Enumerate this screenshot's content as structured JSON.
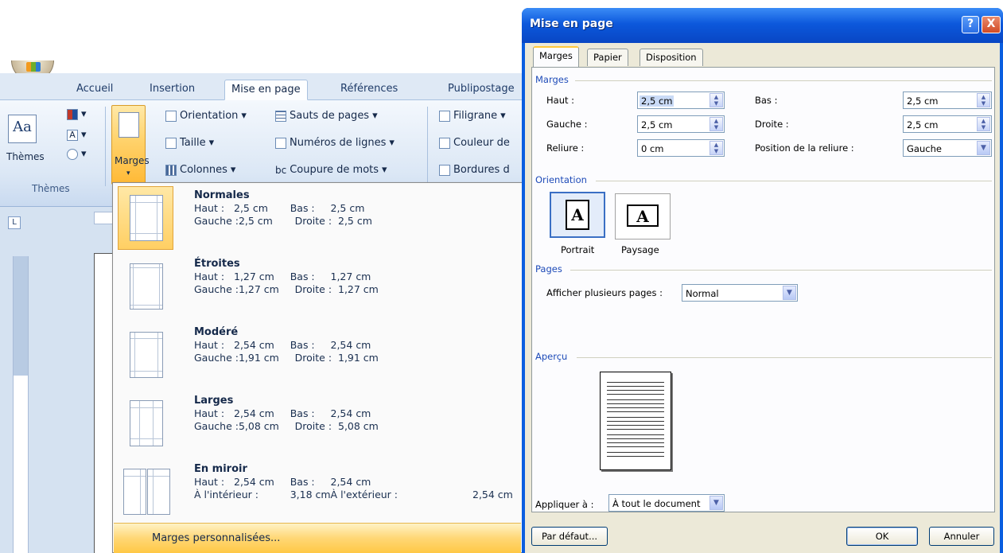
{
  "ribbon": {
    "tabs": [
      "Accueil",
      "Insertion",
      "Mise en page",
      "Références",
      "Publipostage"
    ],
    "active_tab": "Mise en page",
    "themes_label": "Thèmes",
    "themes_group": "Thèmes",
    "marges_label": "Marges",
    "orientation": "Orientation",
    "taille": "Taille",
    "colonnes": "Colonnes",
    "sauts": "Sauts de pages",
    "numeros": "Numéros de lignes",
    "coupure": "Coupure de mots",
    "filigrane": "Filigrane",
    "couleur": "Couleur de",
    "bordures": "Bordures d"
  },
  "margins_menu": {
    "items": [
      {
        "title": "Normales",
        "row1": "Haut :   2,5 cm       Bas :     2,5 cm",
        "row2": "Gauche :2,5 cm       Droite :  2,5 cm"
      },
      {
        "title": "Étroites",
        "row1": "Haut :   1,27 cm     Bas :     1,27 cm",
        "row2": "Gauche :1,27 cm     Droite :  1,27 cm"
      },
      {
        "title": "Modéré",
        "row1": "Haut :   2,54 cm     Bas :     2,54 cm",
        "row2": "Gauche :1,91 cm     Droite :  1,91 cm"
      },
      {
        "title": "Larges",
        "row1": "Haut :   2,54 cm     Bas :     2,54 cm",
        "row2": "Gauche :5,08 cm     Droite :  5,08 cm"
      },
      {
        "title": "En miroir",
        "row1": "Haut :   2,54 cm     Bas :     2,54 cm",
        "row2": "À l'intérieur :          3,18 cmÀ l'extérieur :",
        "row2_extra": "2,54 cm"
      }
    ],
    "custom": "Marges personnalisées..."
  },
  "dialog": {
    "title": "Mise en page",
    "help": "?",
    "close": "X",
    "tabs": [
      "Marges",
      "Papier",
      "Disposition"
    ],
    "active_tab": "Marges",
    "sections": {
      "marges": "Marges",
      "orientation": "Orientation",
      "pages": "Pages",
      "apercu": "Aperçu"
    },
    "fields": {
      "haut_label": "Haut :",
      "haut_value": "2,5 cm",
      "bas_label": "Bas :",
      "bas_value": "2,5 cm",
      "gauche_label": "Gauche :",
      "gauche_value": "2,5 cm",
      "droite_label": "Droite :",
      "droite_value": "2,5 cm",
      "reliure_label": "Reliure :",
      "reliure_value": "0 cm",
      "position_label": "Position de la reliure :",
      "position_value": "Gauche"
    },
    "orientation": {
      "portrait": "Portrait",
      "paysage": "Paysage",
      "selected": "Portrait",
      "glyph": "A"
    },
    "pages": {
      "label": "Afficher plusieurs pages :",
      "value": "Normal"
    },
    "appliquer": {
      "label": "Appliquer à :",
      "value": "À tout le document"
    },
    "buttons": {
      "default": "Par défaut...",
      "ok": "OK",
      "cancel": "Annuler"
    }
  }
}
